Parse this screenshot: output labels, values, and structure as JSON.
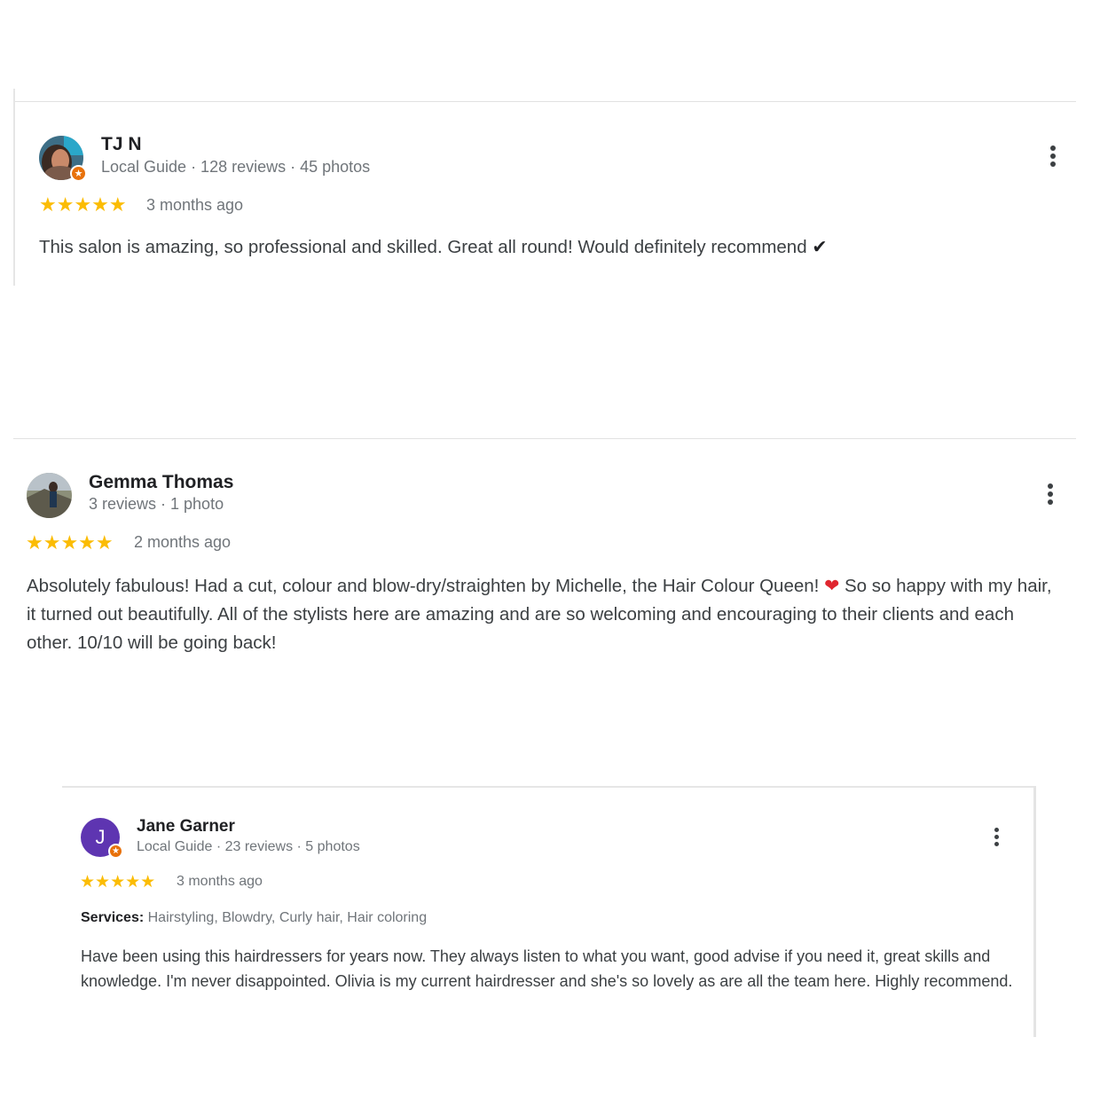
{
  "reviews": [
    {
      "name": "TJ N",
      "meta": "Local Guide · 128 reviews · 45 photos",
      "stars": "★★★★★",
      "rating": 5,
      "time": "3 months ago",
      "text": "This salon is amazing, so professional and skilled. Great all round! Would definitely recommend",
      "text_suffix": "✔",
      "badge_icon": "star-badge-icon"
    },
    {
      "name": "Gemma Thomas",
      "meta": "3 reviews · 1 photo",
      "stars": "★★★★★",
      "rating": 5,
      "time": "2 months ago",
      "text_part1": "Absolutely fabulous! Had a cut, colour and blow-dry/straighten by Michelle, the Hair Colour Queen!",
      "heart": "❤",
      "text_part2": "So so happy with my hair, it turned out beautifully. All of the stylists here are amazing and are so welcoming and encouraging to their clients and each other. 10/10 will be going back!"
    },
    {
      "name": "Jane Garner",
      "avatar_letter": "J",
      "meta": "Local Guide · 23 reviews · 5 photos",
      "stars": "★★★★★",
      "rating": 5,
      "time": "3 months ago",
      "services_label": "Services:",
      "services": "Hairstyling, Blowdry, Curly hair, Hair coloring",
      "text": "Have been using this hairdressers for years now. They always listen to what you want, good advise if you need it, great skills and knowledge. I'm never disappointed. Olivia is my current hairdresser and she's so lovely as are all the team here. Highly recommend.",
      "badge_icon": "star-badge-icon"
    }
  ],
  "colors": {
    "star": "#fbbc04",
    "badge": "#e8710a",
    "avatar_purple": "#5e35b1",
    "meta_text": "#70757a"
  }
}
